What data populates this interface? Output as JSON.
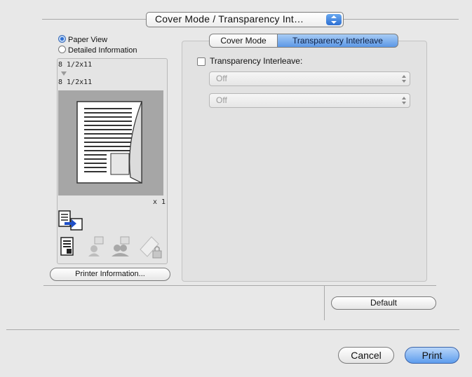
{
  "popup": {
    "label": "Cover Mode / Transparency Int…"
  },
  "view_options": {
    "paper_view": "Paper View",
    "detailed_information": "Detailed Information",
    "selected": "Paper View"
  },
  "preview": {
    "input_size": "8 1/2x11",
    "output_size": "8 1/2x11",
    "copies": "x 1"
  },
  "printer_info_button": "Printer Information...",
  "tabs": [
    {
      "label": "Cover Mode",
      "active": false
    },
    {
      "label": "Transparency Interleave",
      "active": true
    }
  ],
  "transparency": {
    "checkbox_label": "Transparency Interleave:",
    "checked": false,
    "select1_value": "Off",
    "select2_value": "Off"
  },
  "default_button": "Default",
  "cancel_button": "Cancel",
  "print_button": "Print",
  "colors": {
    "accent": "#5e9ded",
    "window_bg": "#e8e8e8"
  }
}
